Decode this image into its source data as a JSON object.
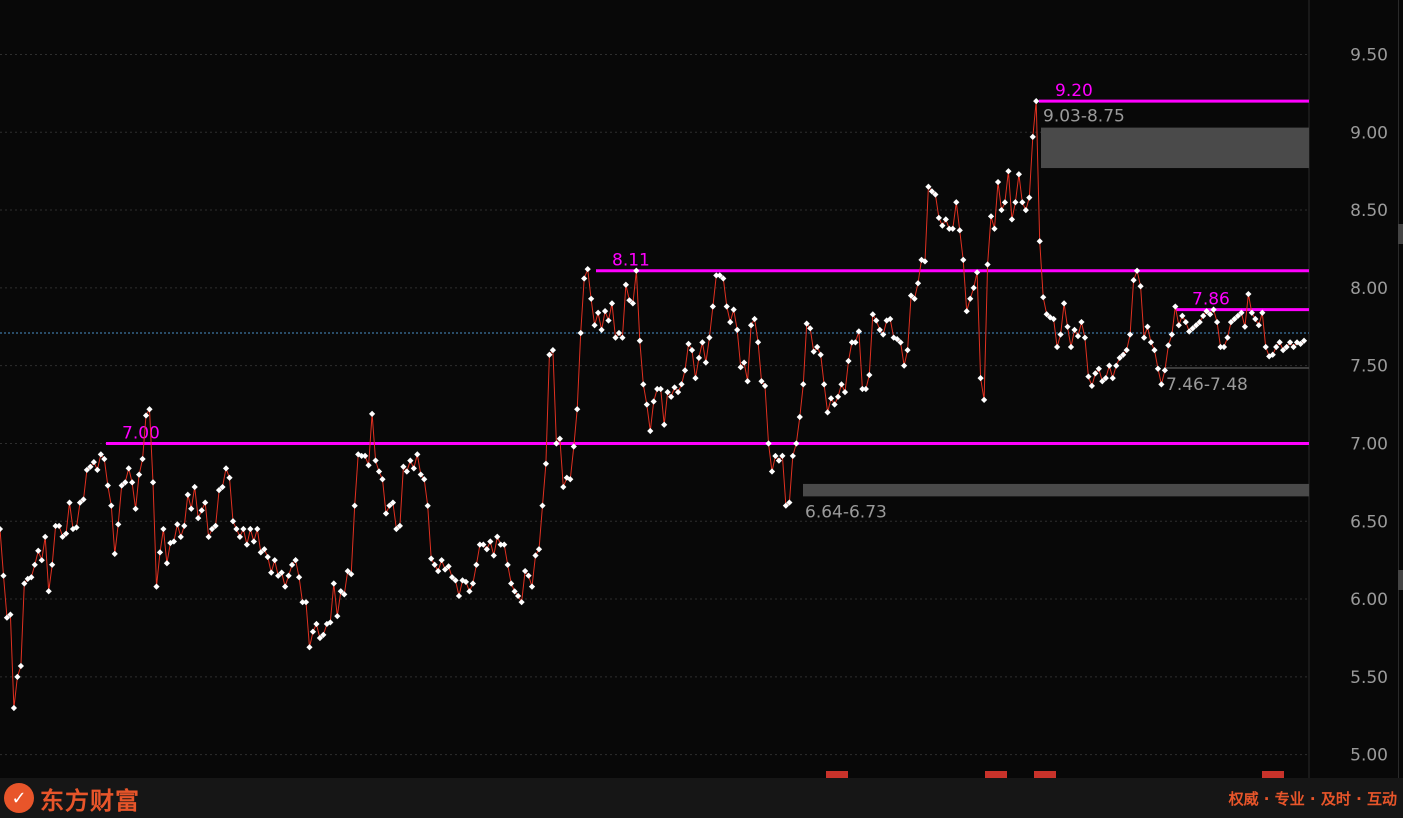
{
  "footer": {
    "brand": "东方财富",
    "slogan": "权威 · 专业 · 及时 · 互动"
  },
  "colors": {
    "background": "#080808",
    "line": "#e03020",
    "point": "#ffffff",
    "level": "#ff00ff",
    "zone": "#4a4a4a",
    "zone_label": "#9a9a9a",
    "axis_label": "#9a9a9a",
    "brand": "#e8552a"
  },
  "chart_data": {
    "type": "line",
    "ylim": [
      4.85,
      9.85
    ],
    "yticks": [
      "9.50",
      "9.00",
      "8.50",
      "8.00",
      "7.50",
      "7.00",
      "6.50",
      "6.00",
      "5.50",
      "5.00"
    ],
    "grid": true,
    "current_price": 7.71,
    "levels": [
      {
        "label": "7.00",
        "value": 7.0
      },
      {
        "label": "8.11",
        "value": 8.11
      },
      {
        "label": "9.20",
        "value": 9.2
      },
      {
        "label": "7.86",
        "value": 7.86
      }
    ],
    "zones": [
      {
        "label": "9.03-8.75",
        "low": 8.77,
        "high": 9.03
      },
      {
        "label": "6.64-6.73",
        "low": 6.66,
        "high": 6.74
      },
      {
        "label": "7.46-7.48",
        "low": 7.48,
        "high": 7.49
      }
    ],
    "series": [
      {
        "values": [
          6.45,
          6.15,
          5.88,
          5.9,
          5.3,
          5.5,
          5.57,
          6.1,
          6.13,
          6.14,
          6.22,
          6.31,
          6.25,
          6.4,
          6.05,
          6.22,
          6.47,
          6.47,
          6.4,
          6.42,
          6.62,
          6.45,
          6.46,
          6.62,
          6.64,
          6.83,
          6.85,
          6.88,
          6.83,
          6.93,
          6.9,
          6.73,
          6.6,
          6.29,
          6.48,
          6.73,
          6.75,
          6.84,
          6.75,
          6.58,
          6.8,
          6.9,
          7.18,
          7.22,
          6.75,
          6.08,
          6.3,
          6.45,
          6.23,
          6.36,
          6.37,
          6.48,
          6.4,
          6.47,
          6.67,
          6.58,
          6.72,
          6.52,
          6.57,
          6.62,
          6.4,
          6.45,
          6.47,
          6.7,
          6.72,
          6.84,
          6.78,
          6.5,
          6.45,
          6.4,
          6.45,
          6.35,
          6.45,
          6.37,
          6.45,
          6.3,
          6.32,
          6.27,
          6.17,
          6.25,
          6.15,
          6.17,
          6.08,
          6.15,
          6.22,
          6.25,
          6.14,
          5.98,
          5.98,
          5.69,
          5.79,
          5.84,
          5.75,
          5.77,
          5.84,
          5.85,
          6.1,
          5.89,
          6.05,
          6.03,
          6.18,
          6.16,
          6.6,
          6.93,
          6.92,
          6.92,
          6.86,
          7.19,
          6.89,
          6.82,
          6.77,
          6.55,
          6.6,
          6.62,
          6.45,
          6.47,
          6.85,
          6.82,
          6.89,
          6.84,
          6.93,
          6.8,
          6.77,
          6.6,
          6.26,
          6.22,
          6.18,
          6.25,
          6.19,
          6.21,
          6.14,
          6.12,
          6.02,
          6.12,
          6.11,
          6.05,
          6.1,
          6.22,
          6.35,
          6.35,
          6.32,
          6.37,
          6.28,
          6.4,
          6.35,
          6.35,
          6.22,
          6.1,
          6.05,
          6.02,
          5.98,
          6.18,
          6.15,
          6.08,
          6.28,
          6.32,
          6.6,
          6.87,
          7.57,
          7.6,
          7.0,
          7.03,
          6.72,
          6.78,
          6.77,
          6.98,
          7.22,
          7.71,
          8.06,
          8.12,
          7.93,
          7.76,
          7.84,
          7.73,
          7.85,
          7.79,
          7.9,
          7.68,
          7.71,
          7.68,
          8.02,
          7.92,
          7.9,
          8.11,
          7.66,
          7.38,
          7.25,
          7.08,
          7.27,
          7.35,
          7.35,
          7.12,
          7.33,
          7.3,
          7.36,
          7.33,
          7.38,
          7.47,
          7.64,
          7.6,
          7.42,
          7.55,
          7.65,
          7.52,
          7.68,
          7.88,
          8.08,
          8.08,
          8.06,
          7.88,
          7.78,
          7.86,
          7.73,
          7.49,
          7.52,
          7.4,
          7.76,
          7.8,
          7.65,
          7.4,
          7.37,
          7.0,
          6.82,
          6.92,
          6.89,
          6.92,
          6.6,
          6.62,
          6.92,
          7.0,
          7.17,
          7.38,
          7.77,
          7.74,
          7.59,
          7.62,
          7.57,
          7.38,
          7.2,
          7.29,
          7.25,
          7.3,
          7.38,
          7.33,
          7.53,
          7.65,
          7.65,
          7.72,
          7.35,
          7.35,
          7.44,
          7.83,
          7.79,
          7.73,
          7.7,
          7.79,
          7.8,
          7.68,
          7.67,
          7.65,
          7.5,
          7.6,
          7.95,
          7.93,
          8.03,
          8.18,
          8.17,
          8.65,
          8.62,
          8.6,
          8.45,
          8.4,
          8.44,
          8.38,
          8.38,
          8.55,
          8.37,
          8.18,
          7.85,
          7.93,
          8.0,
          8.1,
          7.42,
          7.28,
          8.15,
          8.46,
          8.38,
          8.68,
          8.5,
          8.55,
          8.75,
          8.44,
          8.55,
          8.73,
          8.55,
          8.5,
          8.58,
          8.97,
          9.2,
          8.3,
          7.94,
          7.83,
          7.81,
          7.8,
          7.62,
          7.7,
          7.9,
          7.75,
          7.62,
          7.73,
          7.69,
          7.78,
          7.68,
          7.43,
          7.37,
          7.45,
          7.48,
          7.4,
          7.42,
          7.5,
          7.42,
          7.5,
          7.55,
          7.57,
          7.6,
          7.7,
          8.05,
          8.11,
          8.01,
          7.68,
          7.75,
          7.65,
          7.6,
          7.48,
          7.38,
          7.47,
          7.63,
          7.7,
          7.88,
          7.76,
          7.82,
          7.78,
          7.72,
          7.74,
          7.76,
          7.78,
          7.82,
          7.85,
          7.83,
          7.86,
          7.78,
          7.62,
          7.62,
          7.68,
          7.78,
          7.8,
          7.82,
          7.84,
          7.75,
          7.96,
          7.84,
          7.8,
          7.76,
          7.84,
          7.62,
          7.56,
          7.57,
          7.62,
          7.65,
          7.6,
          7.62,
          7.65,
          7.62,
          7.65,
          7.64,
          7.66
        ]
      }
    ]
  }
}
